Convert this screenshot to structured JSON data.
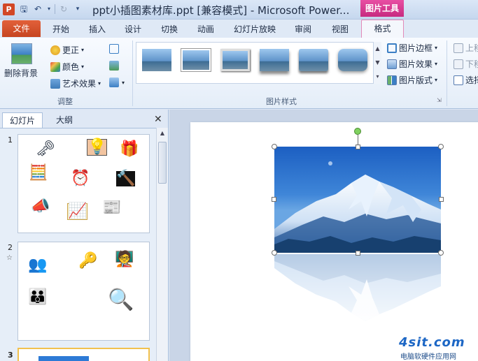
{
  "window": {
    "title": "ppt小插图素材库.ppt [兼容模式] - Microsoft Power...",
    "app_icon": "P",
    "context_tab_header": "图片工具"
  },
  "tabs": {
    "file": "文件",
    "items": [
      "开始",
      "插入",
      "设计",
      "切换",
      "动画",
      "幻灯片放映",
      "审阅",
      "视图"
    ],
    "format": "格式"
  },
  "ribbon": {
    "remove_bg": "删除背景",
    "corrections": "更正",
    "color": "颜色",
    "artistic_effects": "艺术效果",
    "adjust_group": "调整",
    "styles_group": "图片样式",
    "picture_border": "图片边框",
    "picture_effects": "图片效果",
    "picture_layout": "图片版式",
    "bring_forward": "上移",
    "send_backward": "下移",
    "selection_pane": "选择"
  },
  "panel": {
    "tab_slides": "幻灯片",
    "tab_outline": "大纲",
    "close": "✕",
    "slide_numbers": [
      "1",
      "2",
      "3"
    ],
    "slide2_star": "☆"
  },
  "watermark": {
    "logo": "4sit.com",
    "text": "电脑软硬件应用网"
  },
  "colors": {
    "file_tab": "#c64520",
    "context_accent": "#c72a80",
    "sky": "#1c5fc2"
  }
}
